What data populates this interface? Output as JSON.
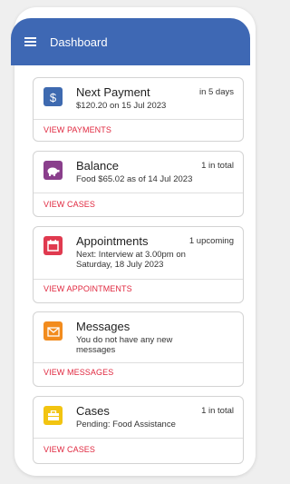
{
  "header": {
    "title": "Dashboard"
  },
  "cards": [
    {
      "title": "Next Payment",
      "meta": "in 5 days",
      "detail": "$120.20 on 15 Jul 2023",
      "action": "VIEW PAYMENTS",
      "icon": "dollar-icon",
      "color": "#3e6ab0"
    },
    {
      "title": "Balance",
      "meta": "1 in total",
      "detail": "Food $65.02 as of 14 Jul 2023",
      "action": "VIEW CASES",
      "icon": "piggy-bank-icon",
      "color": "#8a3f8c"
    },
    {
      "title": "Appointments",
      "meta": "1 upcoming",
      "detail": "Next: Interview at 3.00pm on Saturday, 18 July 2023",
      "action": "VIEW APPOINTMENTS",
      "icon": "calendar-icon",
      "color": "#e03a4f"
    },
    {
      "title": "Messages",
      "meta": "",
      "detail": "You do not have any new messages",
      "action": "VIEW MESSAGES",
      "icon": "envelope-icon",
      "color": "#f28c1e"
    },
    {
      "title": "Cases",
      "meta": "1 in total",
      "detail": "Pending: Food Assistance",
      "action": "VIEW CASES",
      "icon": "briefcase-icon",
      "color": "#f2c411"
    }
  ]
}
